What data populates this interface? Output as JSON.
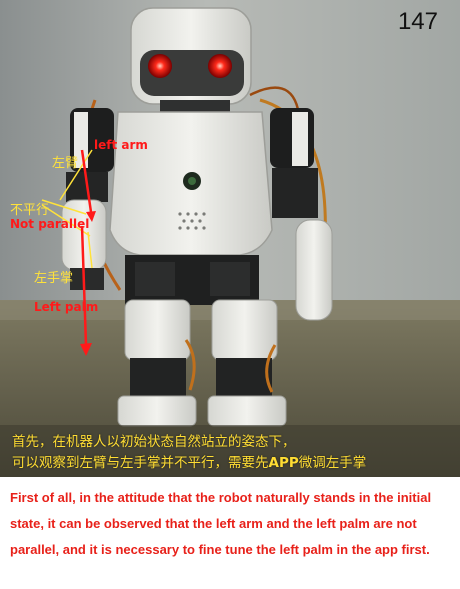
{
  "page_number": "147",
  "annotations": {
    "left_arm_cn": "左臂",
    "left_arm_en": "left arm",
    "not_parallel_cn": "不平行",
    "not_parallel_en": "Not parallel",
    "left_palm_cn": "左手掌",
    "left_palm_en": "Left palm"
  },
  "caption_cn": {
    "line1": "首先，在机器人以初始状态自然站立的姿态下，",
    "line2_pre": "可以观察到左臂与左手掌并不平行，需要先",
    "line2_app": "APP",
    "line2_post": "微调左手掌"
  },
  "caption_en": "First of all, in the attitude that the robot naturally stands in the initial state, it can be observed that the left arm and the left palm are not parallel, and it is necessary to fine tune the left palm in the app first.",
  "colors": {
    "annotation_red": "#ff1a1a",
    "annotation_yellow": "#ffe23a",
    "caption_red": "#e8211a"
  }
}
